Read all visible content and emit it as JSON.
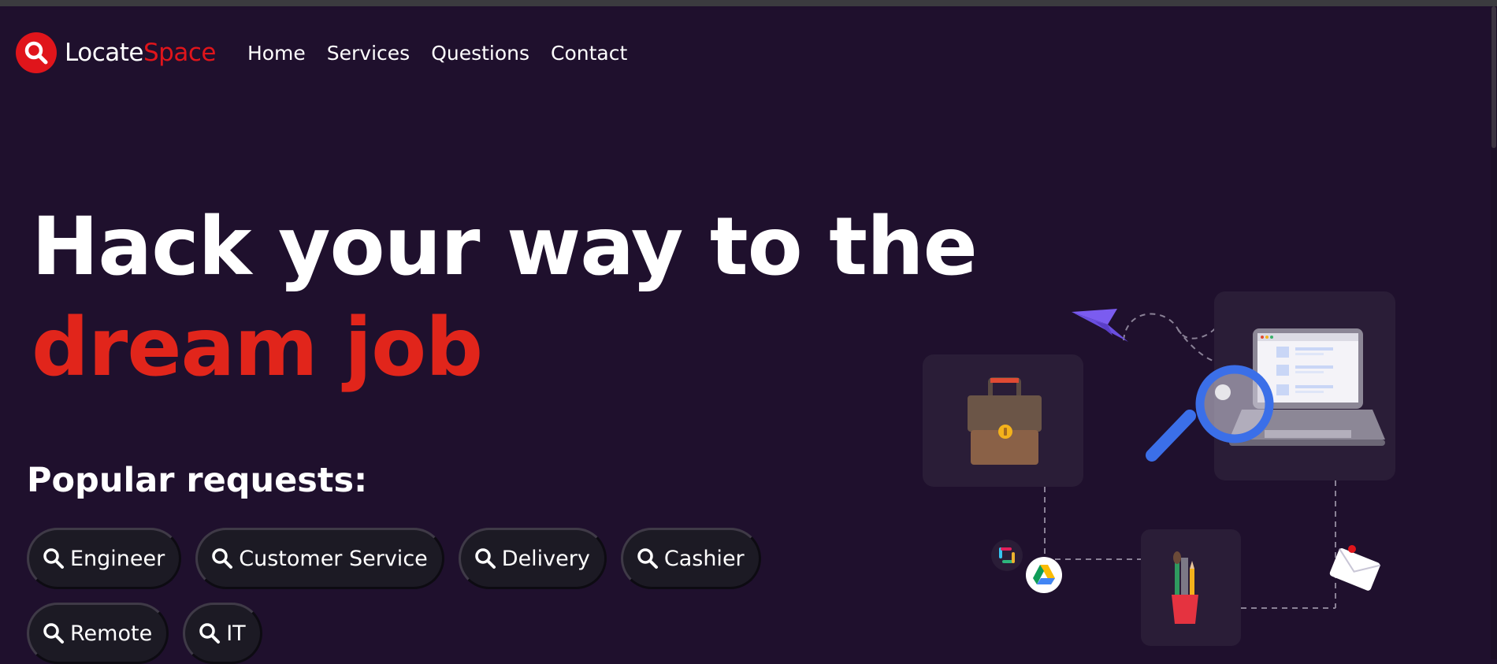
{
  "brand": {
    "name_part1": "Locate",
    "name_part2": "Space",
    "accent_color": "#e0151b",
    "icon": "search-icon"
  },
  "nav": {
    "links": [
      "Home",
      "Services",
      "Questions",
      "Contact"
    ]
  },
  "hero": {
    "title_line1": "Hack your way to the",
    "title_line2": "dream job",
    "title_line2_color": "#e1251b"
  },
  "popular": {
    "heading": "Popular requests:",
    "chips": [
      {
        "label": "Engineer",
        "icon": "search-icon"
      },
      {
        "label": "Customer Service",
        "icon": "search-icon"
      },
      {
        "label": "Delivery",
        "icon": "search-icon"
      },
      {
        "label": "Cashier",
        "icon": "search-icon"
      },
      {
        "label": "Remote",
        "icon": "search-icon"
      },
      {
        "label": "IT",
        "icon": "search-icon"
      }
    ]
  },
  "theme": {
    "background": "#1f102d",
    "panel": "#2a1d37",
    "text": "#ffffff"
  }
}
